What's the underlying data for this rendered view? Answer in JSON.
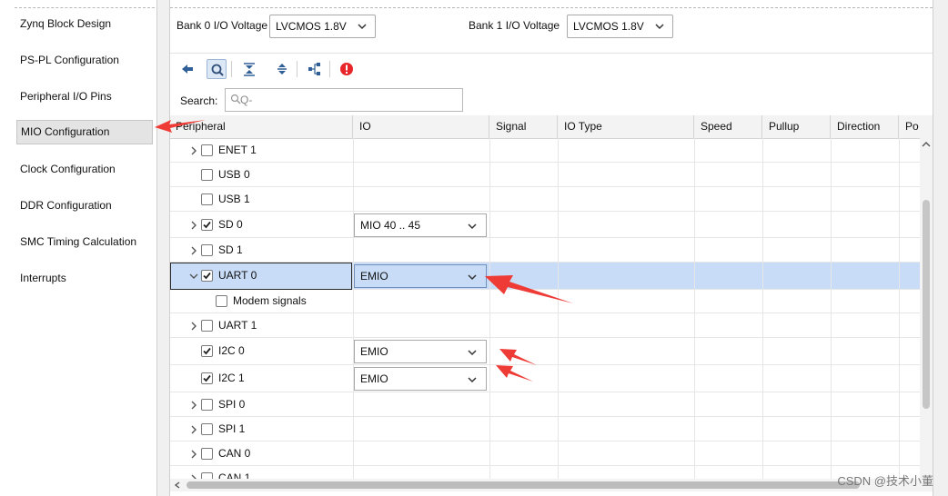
{
  "sidebar": {
    "items": [
      {
        "label": "Zynq Block Design"
      },
      {
        "label": "PS-PL Configuration"
      },
      {
        "label": "Peripheral I/O Pins"
      },
      {
        "label": "MIO Configuration"
      },
      {
        "label": "Clock Configuration"
      },
      {
        "label": "DDR Configuration"
      },
      {
        "label": "SMC Timing Calculation"
      },
      {
        "label": "Interrupts"
      }
    ],
    "active_index": 3
  },
  "bank0": {
    "label": "Bank 0 I/O Voltage",
    "value": "LVCMOS 1.8V"
  },
  "bank1": {
    "label": "Bank 1 I/O Voltage",
    "value": "LVCMOS 1.8V"
  },
  "toolbar": {
    "icons": [
      "back-arrow-icon",
      "search-icon",
      "collapse-all-icon",
      "expand-all-icon",
      "hierarchy-icon",
      "error-icon"
    ],
    "error_color": "#e8262a"
  },
  "search": {
    "label": "Search:",
    "placeholder": "Q-"
  },
  "table": {
    "columns": [
      "Peripheral",
      "IO",
      "Signal",
      "IO Type",
      "Speed",
      "Pullup",
      "Direction",
      "Po"
    ],
    "rows": [
      {
        "name": "ENET 1",
        "checked": false,
        "expandable": true,
        "io": ""
      },
      {
        "name": "USB 0",
        "checked": false,
        "expandable": false,
        "io": ""
      },
      {
        "name": "USB 1",
        "checked": false,
        "expandable": false,
        "io": ""
      },
      {
        "name": "SD 0",
        "checked": true,
        "expandable": true,
        "io": "MIO 40 .. 45"
      },
      {
        "name": "SD 1",
        "checked": false,
        "expandable": true,
        "io": ""
      },
      {
        "name": "UART 0",
        "checked": true,
        "expandable": true,
        "expanded": true,
        "selected": true,
        "io": "EMIO"
      },
      {
        "name": "Modem signals",
        "checked": false,
        "expandable": false,
        "child": true,
        "io": ""
      },
      {
        "name": "UART 1",
        "checked": false,
        "expandable": true,
        "io": ""
      },
      {
        "name": "I2C 0",
        "checked": true,
        "expandable": false,
        "io": "EMIO"
      },
      {
        "name": "I2C 1",
        "checked": true,
        "expandable": false,
        "io": "EMIO"
      },
      {
        "name": "SPI 0",
        "checked": false,
        "expandable": true,
        "io": ""
      },
      {
        "name": "SPI 1",
        "checked": false,
        "expandable": true,
        "io": ""
      },
      {
        "name": "CAN 0",
        "checked": false,
        "expandable": true,
        "io": ""
      },
      {
        "name": "CAN 1",
        "checked": false,
        "expandable": true,
        "io": ""
      }
    ]
  },
  "annotation_color": "#ee3b36",
  "selection_color": "#c8dcf7",
  "watermark": "CSDN @技术小董"
}
